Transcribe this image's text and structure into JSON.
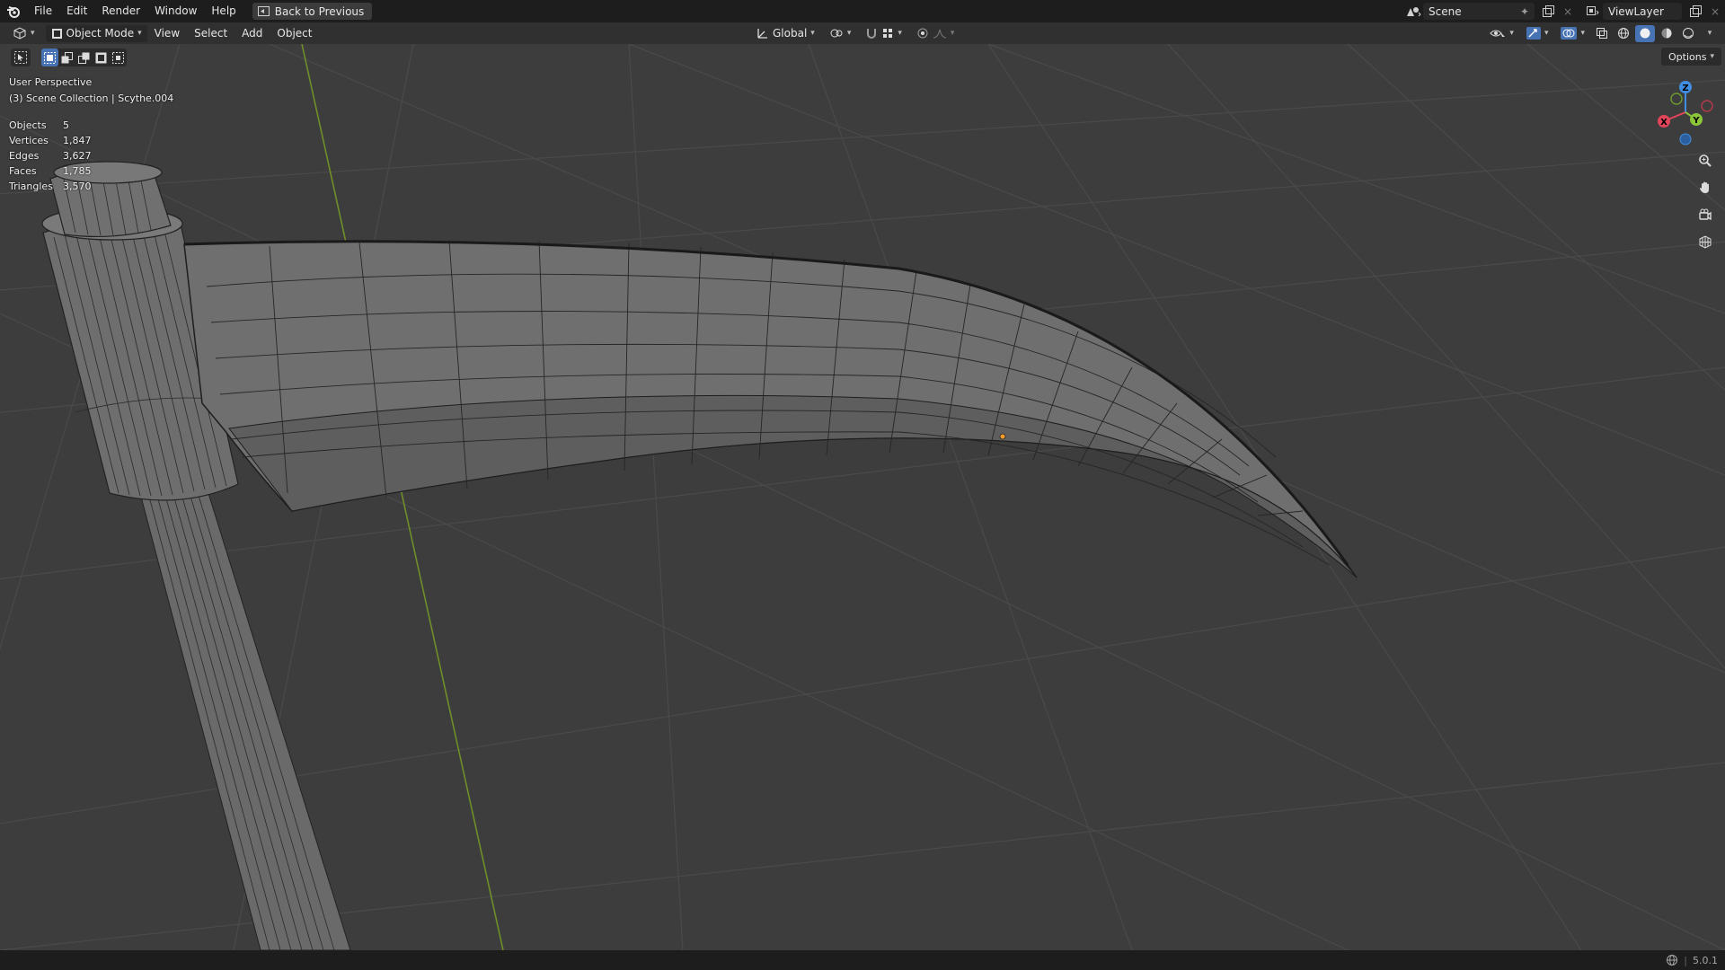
{
  "topbar": {
    "menus": [
      "File",
      "Edit",
      "Render",
      "Window",
      "Help"
    ],
    "back_button": "Back to Previous",
    "scene_name": "Scene",
    "view_layer": "ViewLayer"
  },
  "viewport_header": {
    "mode": "Object Mode",
    "menus": [
      "View",
      "Select",
      "Add",
      "Object"
    ],
    "transform_orientation": "Global"
  },
  "viewport": {
    "perspective": "User Perspective",
    "collection_info": "(3) Scene Collection | Scythe.004",
    "stats": [
      {
        "label": "Objects",
        "value": "5"
      },
      {
        "label": "Vertices",
        "value": "1,847"
      },
      {
        "label": "Edges",
        "value": "3,627"
      },
      {
        "label": "Faces",
        "value": "1,785"
      },
      {
        "label": "Triangles",
        "value": "3,570"
      }
    ],
    "options_label": "Options",
    "gizmo_axes": {
      "x": "X",
      "y": "Y",
      "z": "Z"
    }
  },
  "statusbar": {
    "version": "5.0.1"
  },
  "colors": {
    "header_bg": "#1d1d1d",
    "viewport_bg": "#3d3d3d",
    "grid_line": "#505050",
    "y_axis": "#7a9a2a",
    "x_axis_gizmo": "#e2455a",
    "y_axis_gizmo": "#8bc53a",
    "z_axis_gizmo": "#3f8ee3",
    "active_tool": "#4772b3",
    "mesh_fill": "#6e6e6e",
    "wire": "#222222",
    "origin_dot": "#f29b2c"
  }
}
